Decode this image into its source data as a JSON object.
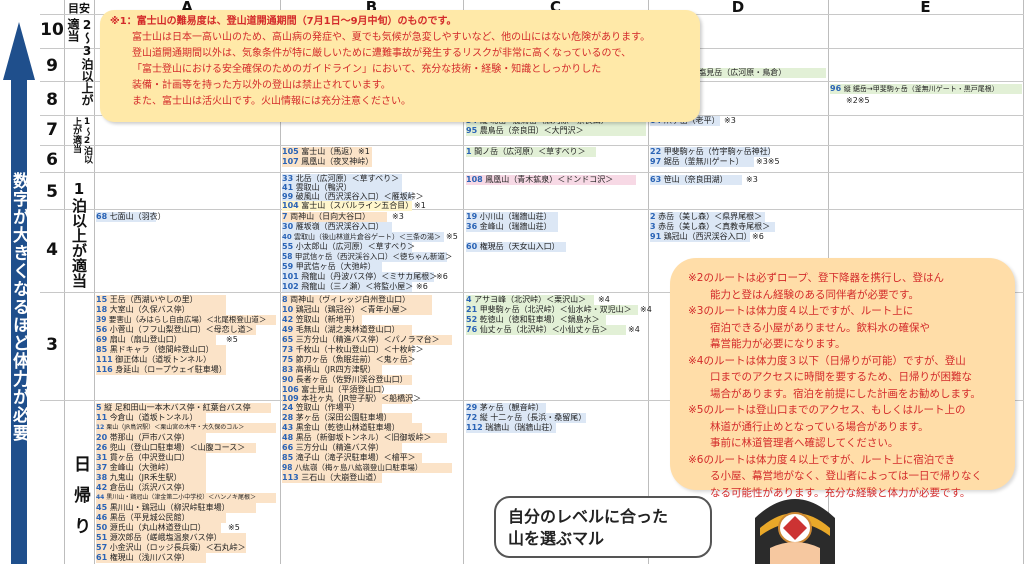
{
  "header": {
    "level_title": "目安",
    "cols": [
      "A",
      "B",
      "C",
      "D",
      "E"
    ]
  },
  "side_text": "数字が大きくなるほど体力が必要",
  "levels": [
    "10",
    "9",
    "8",
    "7",
    "6",
    "5",
    "4",
    "3"
  ],
  "group_labels": {
    "g1": "2〜3泊以上が適当",
    "g2": "1〜2泊以上が適当",
    "g3": "1泊以上が適当",
    "g4": "日帰り"
  },
  "note1": [
    "※1：富士山の難易度は、登山道開通期間（7月1日〜9月中旬）のものです。",
    "富士山は日本一高い山のため、高山病の発症や、夏でも気候が急変しやすいなど、他の山にはない危険があります。",
    "登山道開通期間以外は、気象条件が特に厳しいために遭難事故が発生するリスクが非常に高くなっているので、",
    "「富士登山における安全確保のためのガイドライン」において、充分な技術・経験・知識としっかりした",
    "装備・計画等を持った方以外の登山は禁止されています。",
    "また、富士山は活火山です。火山情報には充分注意ください。"
  ],
  "note2": [
    "※2のルートは必ずロープ、登下降器を携行し、登はん",
    "能力と登はん経験のある同伴者が必要です。",
    "※3のルートは体力度４以上ですが、ルート上に",
    "宿泊できる小屋がありません。飲料水の確保や",
    "幕営能力が必要になります。",
    "※4のルートは体力度３以下（日帰りが可能）ですが、登山",
    "口までのアクセスに時間を要するため、日帰りが困難な",
    "場合があります。宿泊を前提にした計画をお勧めします。",
    "※5のルートは登山口までのアクセス、もしくはルート上の",
    "林道が通行止めとなっている場合があります。",
    "事前に林道管理者へ確認してください。",
    "※6のルートは体力度４以上ですが、ルート上に宿泊でき",
    "る小屋、幕営地がなく、登山者によっては一日で帰りなく",
    "なる可能性があります。充分な経験と体力が必要です。"
  ],
  "bubble": [
    "自分のレベルに合った",
    "山を選ぶマル"
  ],
  "routes": {
    "d9": {
      "n": "35",
      "t": "縦 北岳一塩見岳（広河原・鳥倉）"
    },
    "e8": {
      "n": "96",
      "t": "縦 鋸岳→甲斐駒ヶ岳（釜無川ゲート・黒戸尾根）",
      "mark": "※2※5"
    },
    "c7": [
      {
        "n": "34",
        "t": "縦 北岳→農鳥岳（広河原・奈良田）"
      },
      {
        "n": "95",
        "t": "農鳥岳（奈良田）＜大門沢＞"
      }
    ],
    "d7": {
      "n": "64",
      "t": "爪ヶ岳（老平）",
      "mark": "※3"
    },
    "b6": [
      {
        "n": "105",
        "t": "富士山（馬返）",
        "mark": "※1"
      },
      {
        "n": "107",
        "t": "鳳凰山（夜叉神峠）"
      }
    ],
    "c6": {
      "n": "1",
      "t": "間ノ岳（広河原）＜草すべり＞"
    },
    "d6": [
      {
        "n": "22",
        "t": "甲斐駒ヶ岳（竹宇駒ヶ岳神社）"
      },
      {
        "n": "97",
        "t": "鋸岳（釜無川ゲート）",
        "mark": "※3※5"
      }
    ],
    "b5": [
      {
        "n": "33",
        "t": "北岳（広河原）＜草すべり＞"
      },
      {
        "n": "41",
        "t": "雲取山（鴨沢）"
      },
      {
        "n": "99",
        "t": "破風山（西沢渓谷入口）＜雁坂峠＞"
      },
      {
        "n": "104",
        "t": "富士山（スバルライン五合目）",
        "mark": "※1"
      }
    ],
    "c5": {
      "n": "108",
      "t": "鳳凰山（青木鉱泉）＜ドンドコ沢＞"
    },
    "d5": {
      "n": "63",
      "t": "笹山（奈良田湖）",
      "mark": "※3"
    },
    "a4": {
      "n": "68",
      "t": "七面山（羽衣）"
    },
    "b4": [
      {
        "n": "7",
        "t": "両神山（日向大谷口）",
        "mark": "※3"
      },
      {
        "n": "30",
        "t": "雁坂嶺（西沢渓谷入口）"
      },
      {
        "n": "40",
        "t": "雲取山（後山林道片倉谷ゲート）＜三条の湯＞",
        "mark": "※5"
      },
      {
        "n": "55",
        "t": "小太郎山（広河原）＜草すべり＞"
      },
      {
        "n": "58",
        "t": "甲武信ヶ岳（西沢渓谷入口）＜徳ちゃん新道＞"
      },
      {
        "n": "59",
        "t": "甲武信ヶ岳（大弛峠）"
      },
      {
        "n": "101",
        "t": "飛龍山（丹波バス停）＜ミサカ尾根＞",
        "mark": "※6"
      },
      {
        "n": "102",
        "t": "飛龍山（三ノ瀬）＜将監小屋＞",
        "mark": "※6"
      }
    ],
    "c4": [
      {
        "n": "19",
        "t": "小川山（瑞牆山荘）"
      },
      {
        "n": "36",
        "t": "金峰山（瑞牆山荘）"
      },
      {
        "n": "60",
        "t": "権現岳（天女山入口）"
      }
    ],
    "d4": [
      {
        "n": "2",
        "t": "赤岳（美し森）＜県界尾根＞"
      },
      {
        "n": "3",
        "t": "赤岳（美し森）＜真教寺尾根＞"
      },
      {
        "n": "91",
        "t": "鶏冠山（西沢渓谷入口）",
        "mark": "※6"
      }
    ],
    "a3": [
      {
        "n": "15",
        "t": "王岳（西湖いやしの里）"
      },
      {
        "n": "18",
        "t": "大室山（久保バス停）"
      },
      {
        "n": "39",
        "t": "要害山（みはらし自由広場）＜北尾根登山道＞"
      },
      {
        "n": "56",
        "t": "小菅山（フフ山梨登山口）＜母恋し道＞"
      },
      {
        "n": "69",
        "t": "扇山（扇山登山口）",
        "mark": "※5"
      },
      {
        "n": "85",
        "t": "黒ドキャラ（徳間峠登山口）"
      },
      {
        "n": "111",
        "t": "御正体山（道坂トンネル）"
      },
      {
        "n": "116",
        "t": "身延山（ロープウェイ駐車場）"
      }
    ],
    "b3": [
      {
        "n": "8",
        "t": "両神山（ヴィレッジ白州登山口）"
      },
      {
        "n": "10",
        "t": "鶏冠山（鶏冠谷）＜青年小屋＞"
      },
      {
        "n": "42",
        "t": "笠取山（新地平）"
      },
      {
        "n": "49",
        "t": "毛無山（湖之奥林道登山口）"
      },
      {
        "n": "65",
        "t": "三方分山（精進バス停）＜パノラマ台＞"
      },
      {
        "n": "73",
        "t": "千枚山（十枚山登山口）＜十枚峠＞"
      },
      {
        "n": "75",
        "t": "節刀ヶ岳（魚眠荘前）＜鬼ヶ岳＞"
      },
      {
        "n": "83",
        "t": "高柄山（JR四方津駅）"
      },
      {
        "n": "90",
        "t": "長者ヶ岳（佐野川渓谷登山口）"
      },
      {
        "n": "106",
        "t": "富士見山（平須登山口）"
      },
      {
        "n": "109",
        "t": "本社ヶ丸（JR笹子駅）＜船橋沢＞"
      }
    ],
    "c3": [
      {
        "n": "4",
        "t": "アサヨ峰（北沢峠）＜栗沢山＞",
        "mark": "※4"
      },
      {
        "n": "21",
        "t": "甲斐駒ヶ岳（北沢峠）＜仙水峠・双児山＞",
        "mark": "※4"
      },
      {
        "n": "52",
        "t": "乾徳山（徳和駐車場）＜鍋島水＞"
      },
      {
        "n": "76",
        "t": "仙丈ヶ岳（北沢峠）＜小仙丈ヶ岳＞",
        "mark": "※4"
      }
    ],
    "a2": [
      {
        "n": "5",
        "t": "縦 足和田山一本木バス停・紅葉台バス停"
      },
      {
        "n": "11",
        "t": "今倉山（道坂トンネル）"
      },
      {
        "n": "12",
        "t": "栗山（JR鳥沢駅）＜栗山宮の木平・大久保のコル＞"
      },
      {
        "n": "20",
        "t": "帯那山（戸市バス停）"
      },
      {
        "n": "26",
        "t": "兜山（登山口駐車場）＜山腹コース＞"
      },
      {
        "n": "31",
        "t": "貫ヶ岳（中沢登山口）"
      },
      {
        "n": "37",
        "t": "金峰山（大弛峠）"
      },
      {
        "n": "38",
        "t": "九鬼山（JR禾生駅）"
      },
      {
        "n": "42",
        "t": "倉岳山（浜沢バス停）"
      },
      {
        "n": "44",
        "t": "黒川山・鶏冠山（津金第二小中学校）＜ハンノキ尾根＞"
      },
      {
        "n": "45",
        "t": "黒川山・鶏冠山（柳沢峠駐車場）"
      },
      {
        "n": "46",
        "t": "黒岳（平見城公民館）"
      },
      {
        "n": "50",
        "t": "源氏山（丸山林道登山口）",
        "mark": "※5"
      },
      {
        "n": "51",
        "t": "源次郎岳（嵯峨塩温泉バス停）"
      },
      {
        "n": "57",
        "t": "小金沢山（ロッジ長兵衛）＜石丸峠＞"
      },
      {
        "n": "61",
        "t": "権現山（浅川バス停）"
      }
    ],
    "b2": [
      {
        "n": "24",
        "t": "笠取山（作場平）"
      },
      {
        "n": "28",
        "t": "茅ヶ岳（深田公園駐車場）"
      },
      {
        "n": "43",
        "t": "黒金山（乾徳山林道駐車場）"
      },
      {
        "n": "48",
        "t": "黒岳（新御坂トンネル）＜旧御坂峠＞"
      },
      {
        "n": "66",
        "t": "三方分山（精進バス停）"
      },
      {
        "n": "85",
        "t": "滝子山（滝子沢駐車場）＜檜平＞"
      },
      {
        "n": "98",
        "t": "八紘嶺（梅ヶ島八紘嶺登山口駐車場）"
      },
      {
        "n": "113",
        "t": "三石山（大崩登山道）"
      }
    ],
    "c2": [
      {
        "n": "29",
        "t": "茅ヶ岳（観音峠）"
      },
      {
        "n": "72",
        "t": "縦 十二ヶ岳（長浜・桑留尾）"
      },
      {
        "n": "112",
        "t": "瑞牆山（瑞牆山荘）"
      }
    ]
  }
}
